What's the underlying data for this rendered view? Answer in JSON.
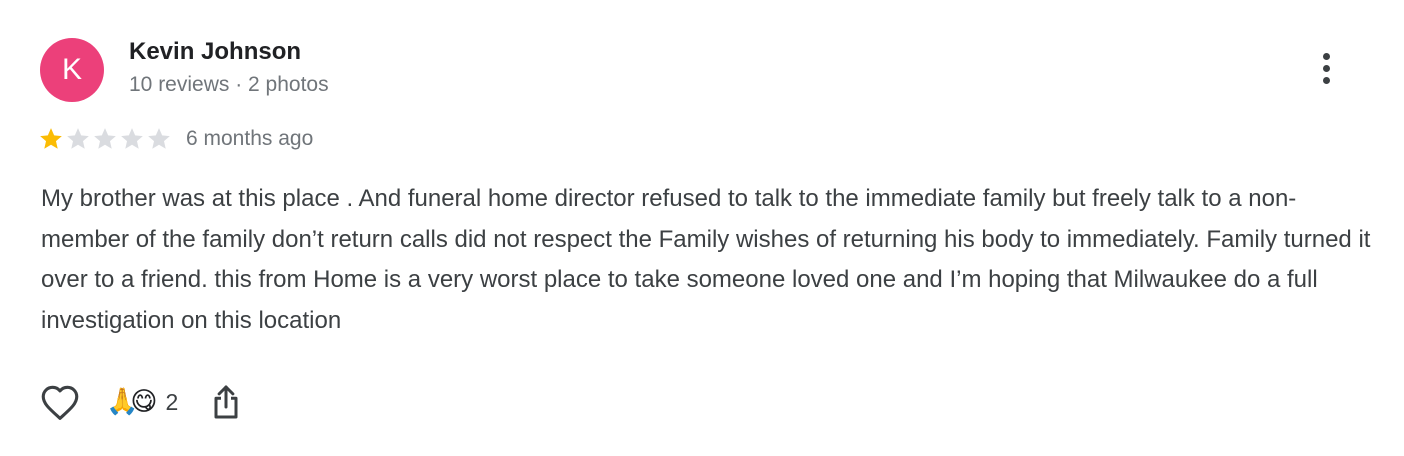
{
  "author": {
    "initial": "K",
    "name": "Kevin Johnson",
    "meta": "10 reviews · 2 photos",
    "avatar_color": "#ec407a"
  },
  "review": {
    "rating": 1,
    "max_rating": 5,
    "date": "6 months ago",
    "text": "My brother was at this place . And funeral home director refused to talk to the immediate family but freely talk to a non-member of the family don’t return calls did not respect the Family wishes of returning his body to immediately. Family turned it over to a friend. this from Home is a very worst place to take someone loved one and I’m hoping that Milwaukee do a full investigation on this location"
  },
  "actions": {
    "reactions": [
      "🙏",
      "😋"
    ],
    "reaction_count": "2"
  },
  "icons": {
    "more": "more-vert-icon",
    "like": "heart-outline-icon",
    "share": "share-icon",
    "star_filled": "star-filled-icon",
    "star_empty": "star-empty-icon"
  },
  "colors": {
    "star_filled": "#fbbc04",
    "star_empty": "#dadce0"
  }
}
